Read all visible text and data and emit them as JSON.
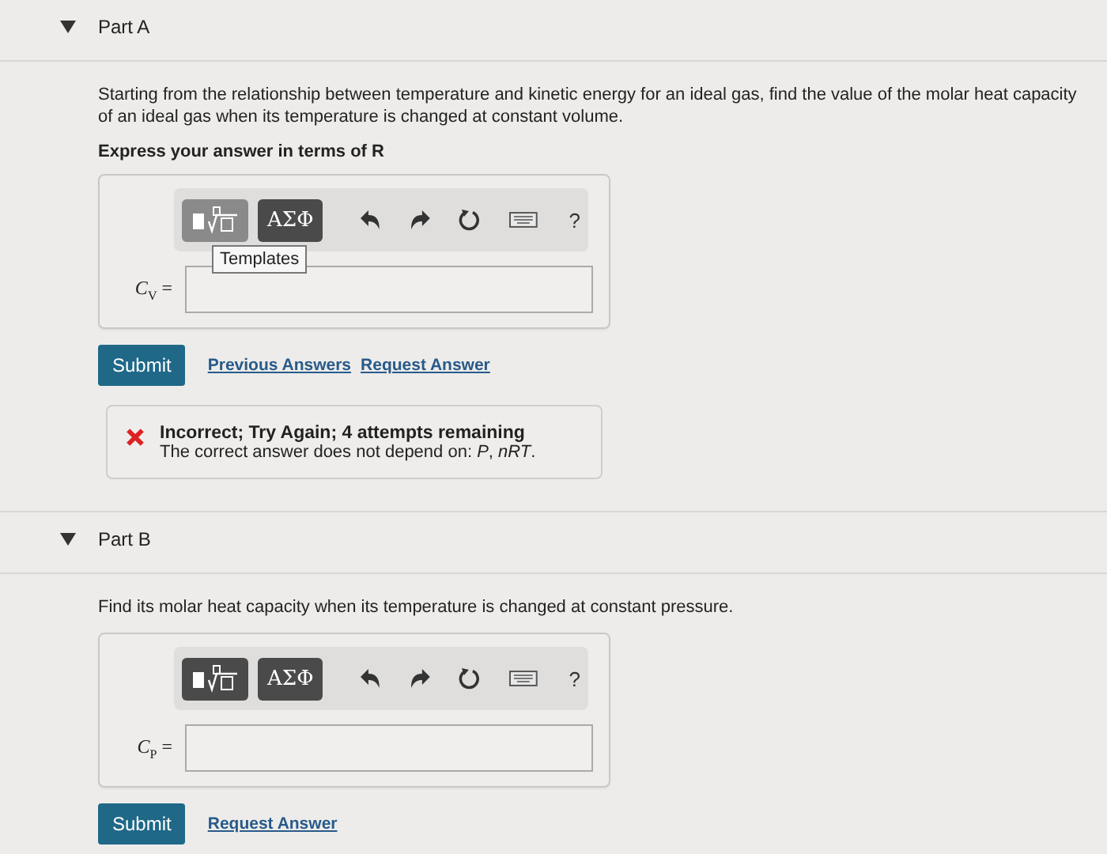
{
  "parts": [
    {
      "title": "Part A",
      "expanded": true,
      "question": "Starting from the relationship between temperature and kinetic energy for an ideal gas, find the value of the molar heat capacity of an ideal gas when its temperature is changed at constant volume.",
      "instruction": "Express your answer in terms of R",
      "toolbar": {
        "templates_hovered": true,
        "tooltip": "Templates",
        "greek": "ΑΣΦ",
        "help": "?"
      },
      "answer_label": "*C*$_{V}$ =",
      "submit": "Submit",
      "links": [
        "Previous Answers",
        "Request Answer"
      ],
      "feedback": {
        "title": "Incorrect; Try Again; 4 attempts remaining",
        "message": "The correct answer does not depend on: *P*, *nRT*."
      }
    },
    {
      "title": "Part B",
      "expanded": true,
      "question": "Find its molar heat capacity when its temperature is changed at constant pressure.",
      "toolbar": {
        "templates_hovered": false,
        "greek": "ΑΣΦ",
        "help": "?"
      },
      "answer_label": "*C*$_{P}$ =",
      "submit": "Submit",
      "links": [
        "Request Answer"
      ]
    }
  ]
}
